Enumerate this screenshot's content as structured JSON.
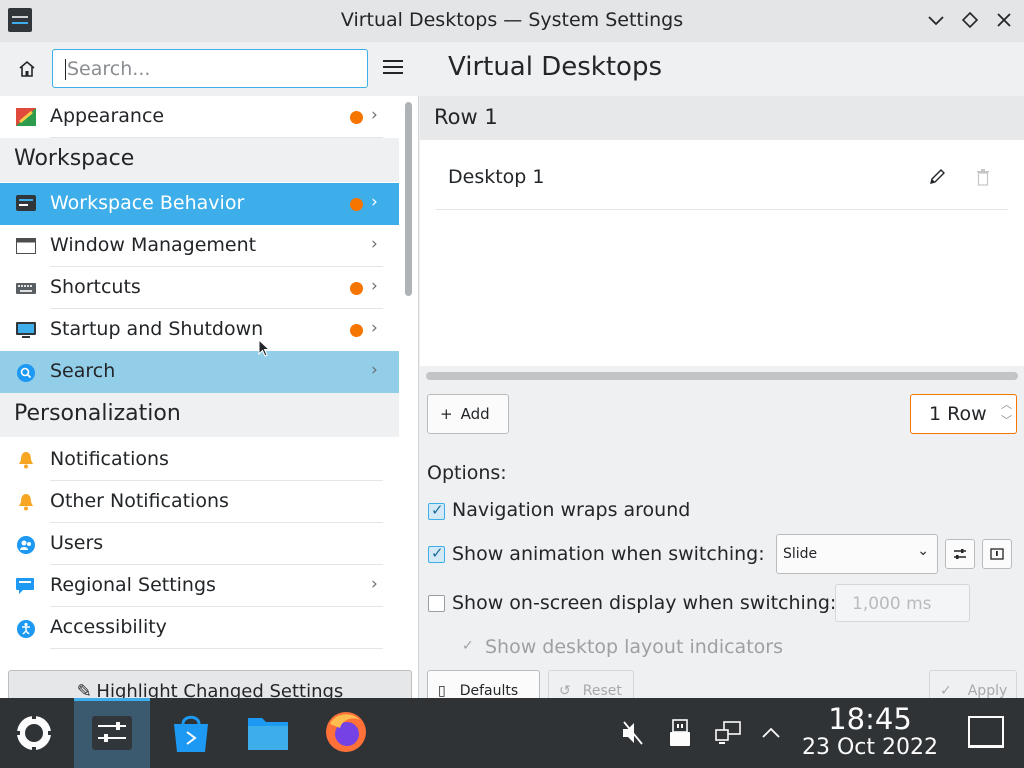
{
  "window": {
    "title": "Virtual Desktops — System Settings",
    "controls": [
      "minimize",
      "maximize",
      "close"
    ]
  },
  "sidebar": {
    "search_placeholder": "Search...",
    "items": [
      {
        "label": "Appearance",
        "changed": true,
        "has_children": true,
        "icon": "appearance-icon"
      },
      {
        "section": "Workspace"
      },
      {
        "label": "Workspace Behavior",
        "changed": true,
        "has_children": true,
        "selected": true,
        "icon": "workspace-icon"
      },
      {
        "label": "Window Management",
        "changed": false,
        "has_children": true,
        "icon": "window-icon"
      },
      {
        "label": "Shortcuts",
        "changed": true,
        "has_children": true,
        "icon": "keyboard-icon"
      },
      {
        "label": "Startup and Shutdown",
        "changed": true,
        "has_children": true,
        "icon": "monitor-icon"
      },
      {
        "label": "Search",
        "changed": false,
        "has_children": true,
        "hovered": true,
        "icon": "search-icon"
      },
      {
        "section": "Personalization"
      },
      {
        "label": "Notifications",
        "icon": "bell-icon"
      },
      {
        "label": "Other Notifications",
        "icon": "bell-icon"
      },
      {
        "label": "Users",
        "icon": "users-icon"
      },
      {
        "label": "Regional Settings",
        "has_children": true,
        "icon": "flag-icon"
      },
      {
        "label": "Accessibility",
        "icon": "accessibility-icon"
      }
    ],
    "highlight_button": "Highlight Changed Settings"
  },
  "main": {
    "title": "Virtual Desktops",
    "row_label": "Row 1",
    "desktops": [
      "Desktop 1"
    ],
    "add_label": "Add",
    "rows_value": "1 Row",
    "options_label": "Options:",
    "options": {
      "wrap": {
        "label": "Navigation wraps around",
        "checked": true
      },
      "animation": {
        "label": "Show animation when switching:",
        "checked": true,
        "value": "Slide"
      },
      "osd": {
        "label": "Show on-screen display when switching:",
        "checked": false,
        "value": "1,000 ms"
      },
      "layout": {
        "label": "Show desktop layout indicators",
        "checked": true,
        "enabled": false
      }
    },
    "defaults_label": "Defaults",
    "reset_label": "Reset",
    "apply_label": "Apply"
  },
  "taskbar": {
    "time": "18:45",
    "date": "23 Oct 2022"
  },
  "colors": {
    "accent": "#3daee9",
    "changed_dot": "#f67400",
    "taskbar": "#2f3336"
  }
}
